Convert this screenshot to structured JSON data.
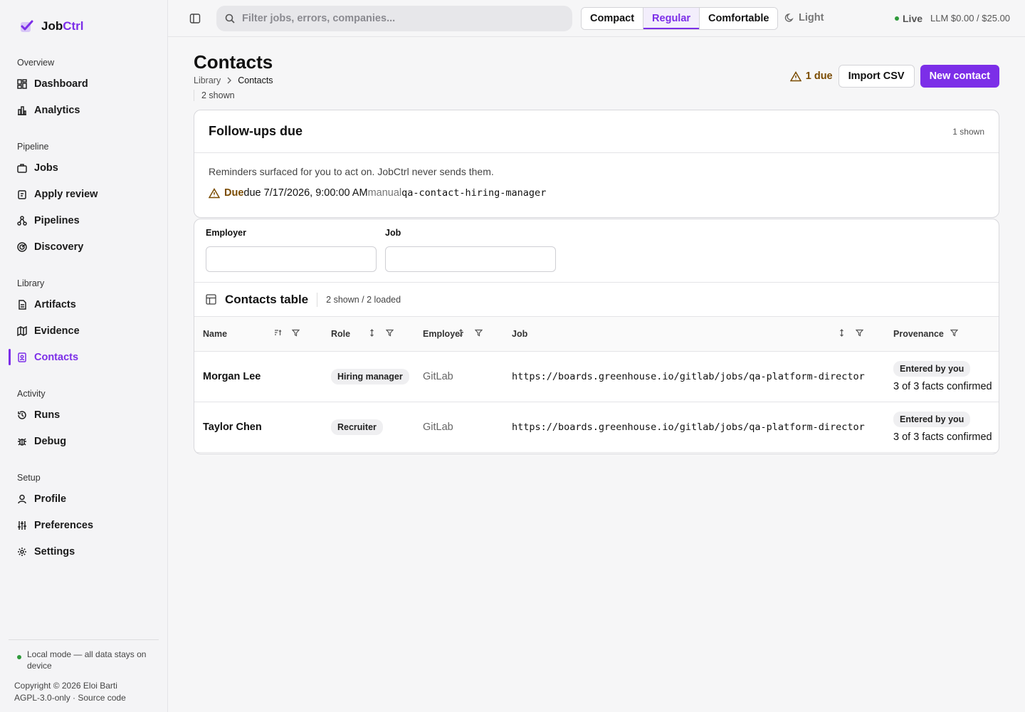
{
  "brand": {
    "name_plain": "Job",
    "name_accent": "Ctrl"
  },
  "sidebar": {
    "groups": [
      {
        "title": "Overview",
        "items": [
          {
            "label": "Dashboard",
            "icon": "dashboard-icon"
          },
          {
            "label": "Analytics",
            "icon": "bar-chart-icon"
          }
        ]
      },
      {
        "title": "Pipeline",
        "items": [
          {
            "label": "Jobs",
            "icon": "briefcase-icon"
          },
          {
            "label": "Apply review",
            "icon": "clipboard-icon"
          },
          {
            "label": "Pipelines",
            "icon": "workflow-icon"
          },
          {
            "label": "Discovery",
            "icon": "radar-icon"
          }
        ]
      },
      {
        "title": "Library",
        "items": [
          {
            "label": "Artifacts",
            "icon": "file-icon"
          },
          {
            "label": "Evidence",
            "icon": "map-icon"
          },
          {
            "label": "Contacts",
            "icon": "contact-book-icon",
            "active": true
          }
        ]
      },
      {
        "title": "Activity",
        "items": [
          {
            "label": "Runs",
            "icon": "history-icon"
          },
          {
            "label": "Debug",
            "icon": "bug-icon"
          }
        ]
      },
      {
        "title": "Setup",
        "items": [
          {
            "label": "Profile",
            "icon": "user-icon"
          },
          {
            "label": "Preferences",
            "icon": "sliders-icon"
          },
          {
            "label": "Settings",
            "icon": "gear-icon"
          }
        ]
      }
    ],
    "footer": {
      "local_mode": "Local mode — all data stays on device",
      "copyright": "Copyright © 2026 Eloi Barti",
      "license": "AGPL-3.0-only · Source code"
    }
  },
  "topbar": {
    "search_placeholder": "Filter jobs, errors, companies...",
    "density": [
      "Compact",
      "Regular",
      "Comfortable"
    ],
    "density_selected": "Regular",
    "theme_label": "Light",
    "live_label": "Live",
    "llm_budget": "LLM $0.00 / $25.00"
  },
  "page": {
    "title": "Contacts",
    "breadcrumb": [
      "Library",
      "Contacts"
    ],
    "shown": "2 shown",
    "due_badge": "1 due",
    "import_label": "Import CSV",
    "new_label": "New contact"
  },
  "followups": {
    "title": "Follow-ups due",
    "count": "1 shown",
    "description": "Reminders surfaced for you to act on. JobCtrl never sends them.",
    "item": {
      "status": "Due",
      "due_text": "due 7/17/2026, 9:00:00 AM",
      "source": "manual",
      "contact_id": "qa-contact-hiring-manager"
    }
  },
  "filters": {
    "employer_label": "Employer",
    "job_label": "Job"
  },
  "table": {
    "title": "Contacts table",
    "count": "2 shown / 2 loaded",
    "columns": [
      "Name",
      "Role",
      "Employer",
      "Job",
      "Provenance"
    ],
    "rows": [
      {
        "name": "Morgan Lee",
        "role": "Hiring manager",
        "employer": "GitLab",
        "job": "https://boards.greenhouse.io/gitlab/jobs/qa-platform-director",
        "provenance": "Entered by you",
        "facts": "3 of 3 facts confirmed"
      },
      {
        "name": "Taylor Chen",
        "role": "Recruiter",
        "employer": "GitLab",
        "job": "https://boards.greenhouse.io/gitlab/jobs/qa-platform-director",
        "provenance": "Entered by you",
        "facts": "3 of 3 facts confirmed"
      }
    ]
  },
  "colors": {
    "accent": "#7c2ee8",
    "warning": "#7a4b00",
    "live": "#2f9a3b"
  }
}
